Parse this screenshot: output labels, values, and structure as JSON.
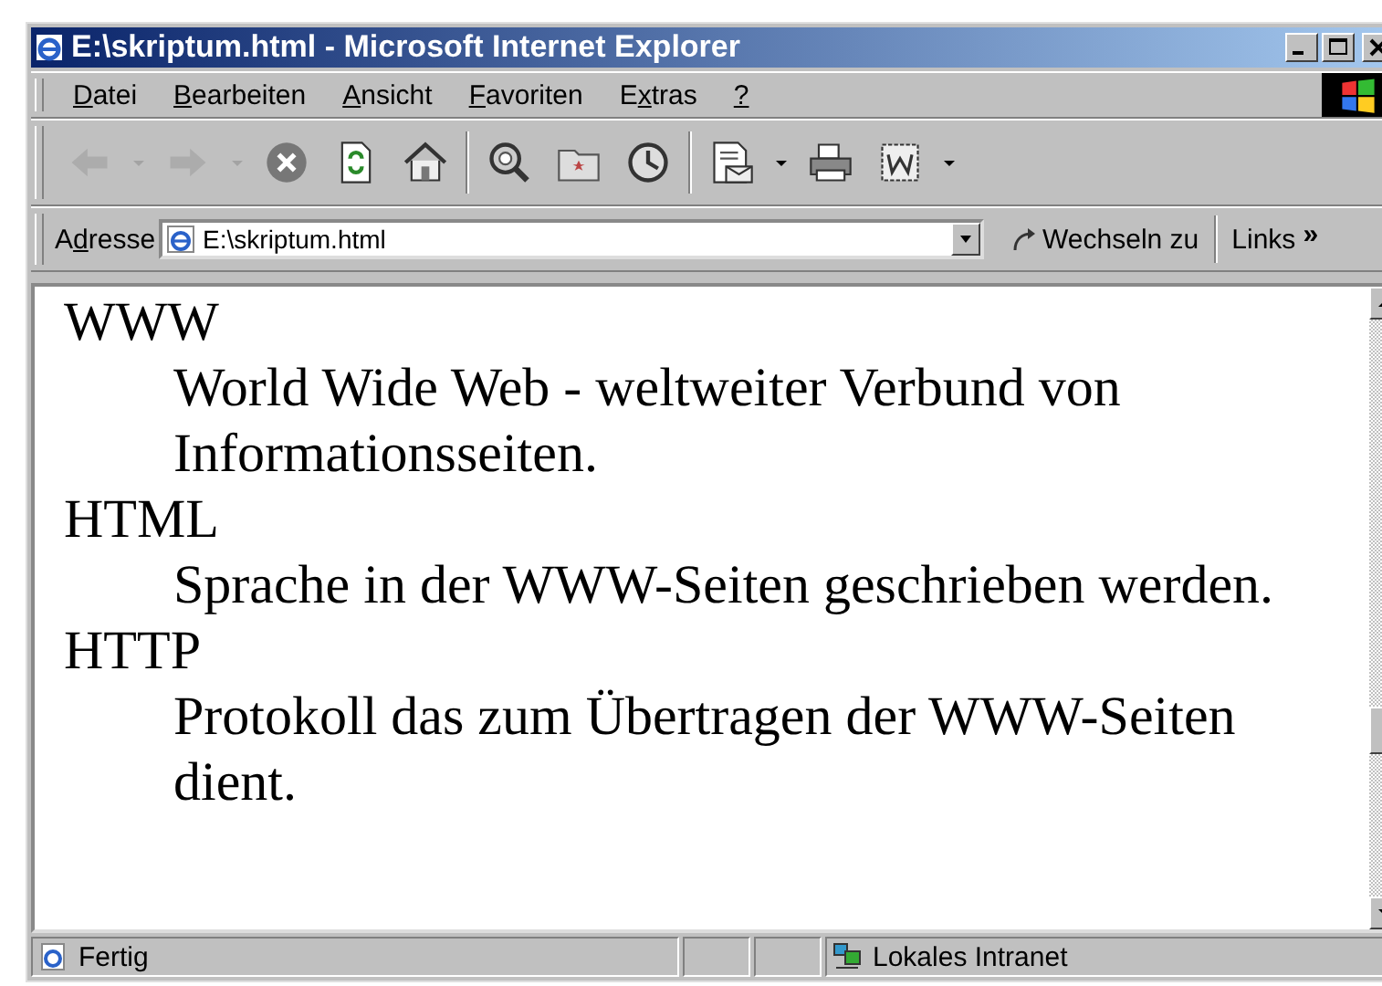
{
  "window": {
    "title": "E:\\skriptum.html - Microsoft Internet Explorer"
  },
  "menu": [
    {
      "key": "D",
      "after": "atei"
    },
    {
      "key": "B",
      "after": "earbeiten"
    },
    {
      "key": "A",
      "after": "nsicht"
    },
    {
      "key": "F",
      "after": "avoriten"
    },
    {
      "before": "E",
      "key": "x",
      "after": "tras"
    },
    {
      "key": "?"
    }
  ],
  "toolbar": [
    {
      "buttons": [
        {
          "kind": "back",
          "disabled": true
        },
        {
          "kind": "dropdown",
          "disabled": true
        },
        {
          "kind": "forward",
          "disabled": true
        },
        {
          "kind": "dropdown",
          "disabled": true
        },
        {
          "kind": "stop",
          "disabled": false
        },
        {
          "kind": "refresh",
          "disabled": false
        },
        {
          "kind": "home",
          "disabled": false
        }
      ]
    },
    {
      "buttons": [
        {
          "kind": "search",
          "disabled": false
        },
        {
          "kind": "favorites",
          "disabled": false
        },
        {
          "kind": "history",
          "disabled": false
        }
      ]
    },
    {
      "buttons": [
        {
          "kind": "mail",
          "disabled": false
        },
        {
          "kind": "dropdown",
          "disabled": false
        },
        {
          "kind": "print",
          "disabled": false
        },
        {
          "kind": "edit",
          "disabled": false
        },
        {
          "kind": "dropdown",
          "disabled": false
        }
      ]
    }
  ],
  "address": {
    "label": {
      "before": "A",
      "key": "d",
      "after": "resse"
    },
    "value": "E:\\skriptum.html",
    "go": "Wechseln zu",
    "links": "Links",
    "more": "»"
  },
  "content": [
    {
      "term": "WWW",
      "definition": "World Wide Web - weltweiter Verbund von Informationsseiten."
    },
    {
      "term": "HTML",
      "definition": "Sprache in der WWW-Seiten geschrieben werden."
    },
    {
      "term": "HTTP",
      "definition": "Protokoll das zum Übertragen der WWW-Seiten dient."
    }
  ],
  "status_bar": {
    "text": "Fertig",
    "zone": "Lokales Intranet"
  }
}
